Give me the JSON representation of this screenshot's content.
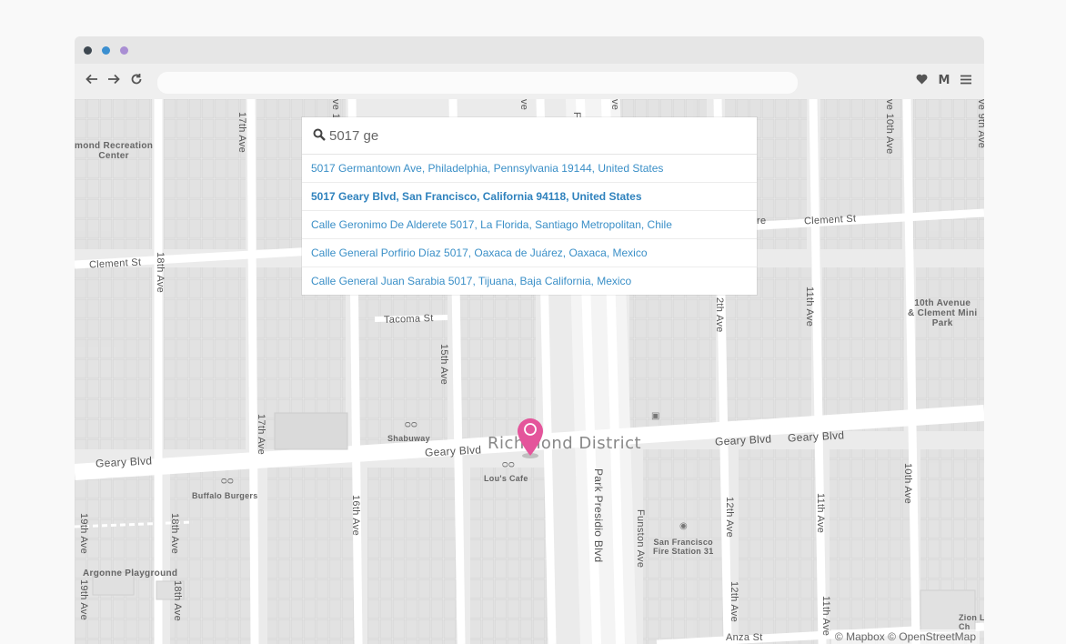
{
  "window": {
    "dots": [
      "#3d4750",
      "#3b8fd0",
      "#a98ed3"
    ]
  },
  "toolbar": {
    "back_icon": "arrow-left",
    "forward_icon": "arrow-right",
    "reload_icon": "reload",
    "url": "",
    "heart_icon": "heart",
    "m_icon": "M",
    "menu_icon": "hamburger"
  },
  "geocoder": {
    "query": "5017 ge",
    "suggestions": [
      {
        "text": "5017 Germantown Ave, Philadelphia, Pennsylvania 19144, United States",
        "active": false
      },
      {
        "text": "5017 Geary Blvd, San Francisco, California 94118, United States",
        "active": true
      },
      {
        "text": "Calle Geronimo De Alderete 5017, La Florida, Santiago Metropolitan, Chile",
        "active": false
      },
      {
        "text": "Calle General Porfirio Díaz 5017, Oaxaca de Juárez, Oaxaca, Mexico",
        "active": false
      },
      {
        "text": "Calle General Juan Sarabia 5017, Tijuana, Baja California, Mexico",
        "active": false
      }
    ]
  },
  "map": {
    "district": "Richmond District",
    "streets": {
      "geary_1": "Geary Blvd",
      "geary_2": "Geary Blvd",
      "geary_3": "Geary Blvd",
      "geary_4": "Geary Blvd",
      "clement_1": "Clement St",
      "clement_2": "Clement St",
      "tacoma": "Tacoma St",
      "park_presidio": "Park Presidio Blvd",
      "funston": "Funston Ave",
      "ave_17_top": "17th Ave",
      "ave_17_mid": "17th Ave",
      "ave_18_top": "18th Ave",
      "ave_18_mid": "18th Ave",
      "ave_18_bot": "18th Ave",
      "ave_19_mid": "19th Ave",
      "ave_19_bot": "19th Ave",
      "ave_16": "16th Ave",
      "ave_15": "15th Ave",
      "ave_12_top": "2th Ave",
      "ave_12_mid": "12th Ave",
      "ave_12_bot": "12th Ave",
      "ave_11_top": "11th Ave",
      "ave_11_mid": "11th Ave",
      "ave_11_bot": "11th Ave",
      "ave_10_top": "ve 10th Ave",
      "ave_10_mid": "10th Ave",
      "ave_9_top": "ve 9th Ave",
      "ave_top_1": "ve 1",
      "ave_top_2": "ve",
      "ave_top_3": "ve",
      "ave_top_4": "F"
    },
    "pois": {
      "recreation": "mond Recreation\nCenter",
      "shabuway": "Shabuway",
      "lous": "Lou's Cafe",
      "buffalo": "Buffalo Burgers",
      "argonne": "Argonne Playground",
      "fire": "San Francisco\nFire Station 31",
      "clement_park": "10th Avenue\n& Clement Mini\nPark",
      "zion": "Zion L\nCh",
      "anza": "Anza St",
      "clement_tr": "re"
    },
    "attribution": "© Mapbox © OpenStreetMap"
  }
}
